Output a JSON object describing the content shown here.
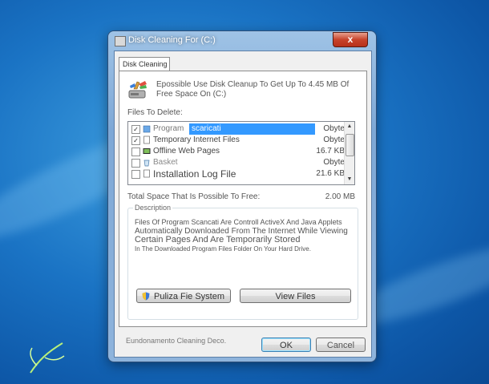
{
  "window": {
    "title": "Disk Cleaning For (C:)",
    "close_symbol": "x"
  },
  "tab": {
    "label": "Disk Cleaning"
  },
  "intro_text": "Epossible Use Disk Cleanup To Get Up To 4.45 MB Of Free Space On (C:)",
  "files_to_delete_label": "Files To Delete:",
  "files": [
    {
      "checked": true,
      "label_prefix": "Program",
      "label": "scaricati",
      "size": "Obyte",
      "selected": true,
      "icon": "folder-icon"
    },
    {
      "checked": true,
      "label": "Temporary Internet Files",
      "size": "Obyte",
      "selected": false,
      "icon": "document-icon"
    },
    {
      "checked": false,
      "label": "Offline Web Pages",
      "size": "16.7 KB",
      "selected": false,
      "icon": "web-page-icon"
    },
    {
      "checked": false,
      "label": "Basket",
      "size": "Obyte",
      "selected": false,
      "icon": "recycle-bin-icon"
    },
    {
      "checked": false,
      "label": "Installation Log File",
      "size": "21.6 KB",
      "selected": false,
      "icon": "document-icon"
    }
  ],
  "check_symbol": "✓",
  "total_label": "Total Space That Is Possible To Free:",
  "total_value": "2.00 MB",
  "description": {
    "legend": "Description",
    "lines": [
      "Files Of Program Scancati Are Controll ActiveX And Java Applets",
      "Automatically Downloaded From The Internet While Viewing",
      "Certain Pages And Are Temporarily Stored",
      "In The Downloaded Program Files Folder On Your Hard Drive."
    ]
  },
  "buttons": {
    "cleanup_system": "Puliza Fie System",
    "view_files": "View Files",
    "ok": "OK",
    "cancel": "Cancel"
  },
  "footer_text": "Eundonamento Cleaning Deco.",
  "scroll_symbols": {
    "up": "▲",
    "down": "▼"
  },
  "colors": {
    "selection": "#3399ff",
    "close_button": "#c7432b",
    "desktop": "#1a73c4"
  }
}
